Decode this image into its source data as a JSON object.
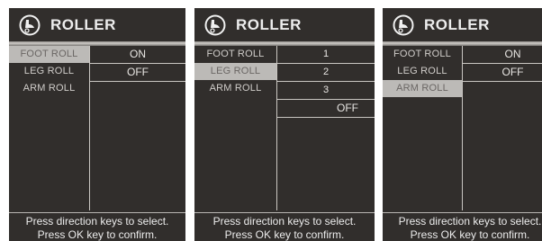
{
  "panels": [
    {
      "title": "ROLLER",
      "menu": [
        "FOOT ROLL",
        "LEG ROLL",
        "ARM ROLL"
      ],
      "selected_index": 0,
      "options": [
        "ON",
        "OFF"
      ],
      "hint_line1": "Press direction keys to select.",
      "hint_line2": "Press OK key to confirm."
    },
    {
      "title": "ROLLER",
      "menu": [
        "FOOT ROLL",
        "LEG ROLL",
        "ARM ROLL"
      ],
      "selected_index": 1,
      "options": [
        "1",
        "2",
        "3",
        "OFF"
      ],
      "hint_line1": "Press direction keys to select.",
      "hint_line2": "Press OK key to confirm."
    },
    {
      "title": "ROLLER",
      "menu": [
        "FOOT ROLL",
        "LEG ROLL",
        "ARM ROLL"
      ],
      "selected_index": 2,
      "options": [
        "ON",
        "OFF"
      ],
      "hint_line1": "Press direction keys to select.",
      "hint_line2": "Press OK key to confirm."
    }
  ],
  "icon": "foot-roller-icon"
}
